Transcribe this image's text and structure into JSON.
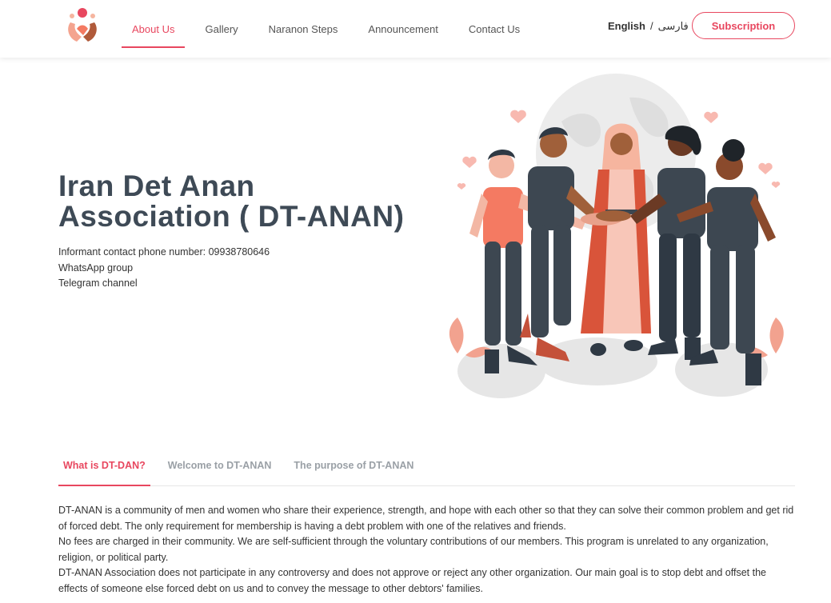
{
  "header": {
    "logo_name": "hands-heart-logo",
    "nav": [
      {
        "label": "About Us",
        "active": true
      },
      {
        "label": "Gallery",
        "active": false
      },
      {
        "label": "Naranon Steps",
        "active": false
      },
      {
        "label": "Announcement",
        "active": false
      },
      {
        "label": "Contact Us",
        "active": false
      }
    ],
    "lang_en": "English",
    "lang_sep": "/",
    "lang_fa": "فارسی",
    "subscription_label": "Subscription"
  },
  "hero": {
    "title": "Iran Det Anan Association ( DT-ANAN)",
    "phone_line": "Informant contact phone number: 09938780646",
    "whatsapp": "WhatsApp group",
    "telegram": "Telegram channel",
    "illustration": "people-hands-together-globe"
  },
  "tabs": [
    {
      "label": "What is DT-DAN?",
      "active": true
    },
    {
      "label": "Welcome to DT-ANAN",
      "active": false
    },
    {
      "label": "The purpose of DT-ANAN",
      "active": false
    }
  ],
  "content": {
    "p1": "DT-ANAN is a community of men and women who share their experience, strength, and hope with each other so that they can solve their common problem and get rid of forced debt. The only requirement for membership is having a debt problem with one of the relatives and friends.",
    "p2": "No fees are charged in their community. We are self-sufficient through the voluntary contributions of our members. This program is unrelated to any organization, religion, or political party.",
    "p3": "DT-ANAN Association does not participate in any controversy and does not approve or reject any other organization. Our main goal is to stop debt and offset the effects of someone else forced debt on us and to convey the message to other debtors' families."
  },
  "colors": {
    "accent": "#e8475f",
    "title": "#3e4a56",
    "skin_dark": "#a0603a",
    "salmon": "#f47a62",
    "slate": "#3d4751"
  }
}
